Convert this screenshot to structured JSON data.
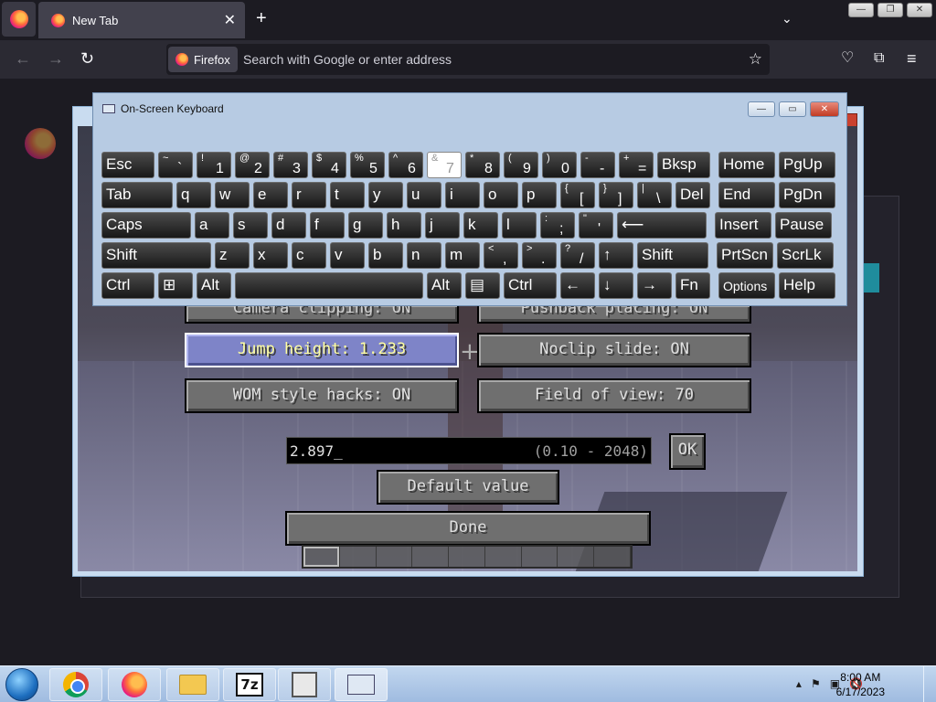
{
  "browser": {
    "tab_title": "New Tab",
    "tab_close": "✕",
    "new_tab": "+",
    "tab_list": "⌄",
    "url_identity": "Firefox",
    "url_placeholder": "Search with Google or enter address",
    "back": "←",
    "forward": "→",
    "reload": "↻",
    "bookmark_star": "☆",
    "pocket": "♡",
    "extensions": "⧉",
    "menu": "≡",
    "window_controls": [
      "—",
      "❐",
      "✕"
    ]
  },
  "osk": {
    "title": "On-Screen Keyboard",
    "controls": [
      "—",
      "▭",
      "✕"
    ],
    "rows": [
      [
        {
          "main": "Esc"
        },
        {
          "top": "~",
          "bot": "`"
        },
        {
          "top": "!",
          "bot": "1"
        },
        {
          "top": "@",
          "bot": "2"
        },
        {
          "top": "#",
          "bot": "3"
        },
        {
          "top": "$",
          "bot": "4"
        },
        {
          "top": "%",
          "bot": "5"
        },
        {
          "top": "^",
          "bot": "6"
        },
        {
          "top": "&",
          "bot": "7",
          "pressed": true
        },
        {
          "top": "*",
          "bot": "8"
        },
        {
          "top": "(",
          "bot": "9"
        },
        {
          "top": ")",
          "bot": "0"
        },
        {
          "top": "-",
          "bot": "-"
        },
        {
          "top": "+",
          "bot": "="
        },
        {
          "main": "Bksp"
        },
        {
          "main": "Home"
        },
        {
          "main": "PgUp"
        }
      ],
      [
        {
          "main": "Tab"
        },
        {
          "main": "q"
        },
        {
          "main": "w"
        },
        {
          "main": "e"
        },
        {
          "main": "r"
        },
        {
          "main": "t"
        },
        {
          "main": "y"
        },
        {
          "main": "u"
        },
        {
          "main": "i"
        },
        {
          "main": "o"
        },
        {
          "main": "p"
        },
        {
          "top": "{",
          "bot": "["
        },
        {
          "top": "}",
          "bot": "]"
        },
        {
          "top": "|",
          "bot": "\\"
        },
        {
          "main": "Del"
        },
        {
          "main": "End"
        },
        {
          "main": "PgDn"
        }
      ],
      [
        {
          "main": "Caps"
        },
        {
          "main": "a"
        },
        {
          "main": "s"
        },
        {
          "main": "d"
        },
        {
          "main": "f"
        },
        {
          "main": "g"
        },
        {
          "main": "h"
        },
        {
          "main": "j"
        },
        {
          "main": "k"
        },
        {
          "main": "l"
        },
        {
          "top": ":",
          "bot": ";"
        },
        {
          "top": "\"",
          "bot": "'"
        },
        {
          "main": "⟵"
        },
        {
          "main": "Insert"
        },
        {
          "main": "Pause"
        }
      ],
      [
        {
          "main": "Shift"
        },
        {
          "main": "z"
        },
        {
          "main": "x"
        },
        {
          "main": "c"
        },
        {
          "main": "v"
        },
        {
          "main": "b"
        },
        {
          "main": "n"
        },
        {
          "main": "m"
        },
        {
          "top": "<",
          "bot": ","
        },
        {
          "top": ">",
          "bot": "."
        },
        {
          "top": "?",
          "bot": "/"
        },
        {
          "main": "↑"
        },
        {
          "main": "Shift"
        },
        {
          "main": "PrtScn"
        },
        {
          "main": "ScrLk"
        }
      ],
      [
        {
          "main": "Ctrl"
        },
        {
          "main": "⊞"
        },
        {
          "main": "Alt"
        },
        {
          "main": ""
        },
        {
          "main": "Alt"
        },
        {
          "main": "▤"
        },
        {
          "main": "Ctrl"
        },
        {
          "main": "←"
        },
        {
          "main": "↓"
        },
        {
          "main": "→"
        },
        {
          "main": "Fn"
        },
        {
          "main": "Options"
        },
        {
          "main": "Help"
        }
      ]
    ]
  },
  "game": {
    "partial_buttons": [
      "Camera clipping: ON",
      "Pushback placing: ON"
    ],
    "buttons": [
      {
        "label": "Jump height: 1.233",
        "highlight": true
      },
      {
        "label": "Noclip slide: ON",
        "highlight": false
      },
      {
        "label": "WOM style hacks: ON",
        "highlight": false
      },
      {
        "label": "Field of view: 70",
        "highlight": false
      }
    ],
    "input_value": "2.897_",
    "input_range": "(0.10 - 2048)",
    "ok_label": "OK",
    "default_label": "Default value",
    "done_label": "Done"
  },
  "taskbar": {
    "apps": [
      "chrome",
      "firefox",
      "file-explorer",
      "7-zip",
      "classicube",
      "on-screen-keyboard"
    ],
    "tray_icons": [
      "▴",
      "⚑",
      "▣",
      "🔇"
    ],
    "time": "8:00 AM",
    "date": "6/17/2023"
  }
}
